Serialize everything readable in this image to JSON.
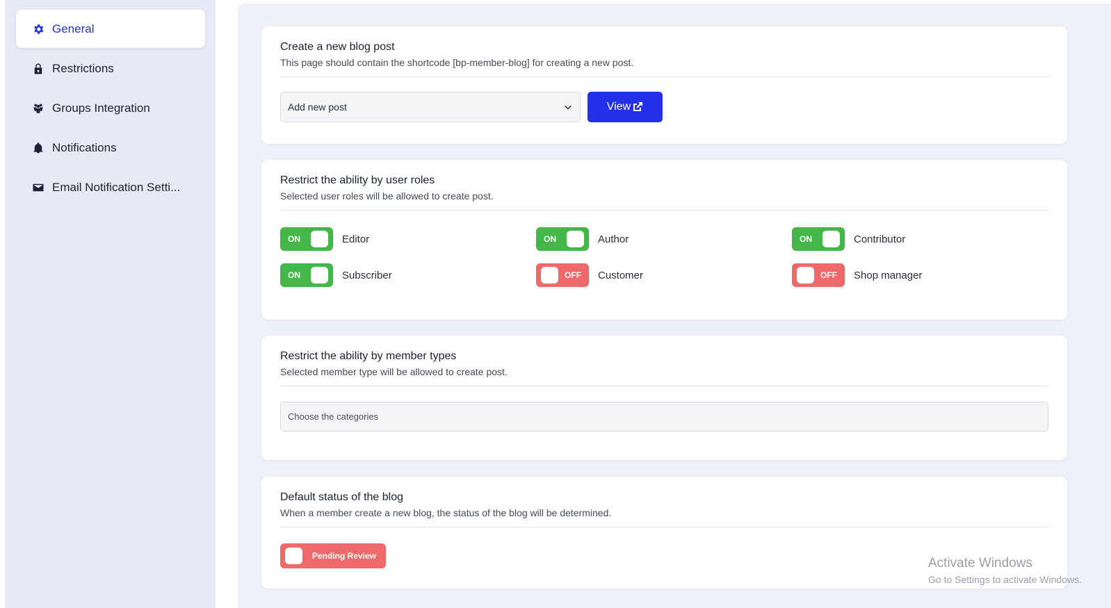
{
  "sidebar": {
    "items": [
      {
        "label": "General",
        "icon": "gear-icon",
        "active": true
      },
      {
        "label": "Restrictions",
        "icon": "lock-icon",
        "active": false
      },
      {
        "label": "Groups Integration",
        "icon": "users-icon",
        "active": false
      },
      {
        "label": "Notifications",
        "icon": "bell-icon",
        "active": false
      },
      {
        "label": "Email Notification Setti...",
        "icon": "envelope-icon",
        "active": false
      }
    ]
  },
  "new_post": {
    "title": "Create a new blog post",
    "description": "This page should contain the shortcode [bp-member-blog] for creating a new post.",
    "select_value": "Add new post",
    "view_label": "View"
  },
  "user_roles": {
    "title": "Restrict the ability by user roles",
    "description": "Selected user roles will be allowed to create post.",
    "roles": [
      {
        "name": "Editor",
        "state": "ON"
      },
      {
        "name": "Author",
        "state": "ON"
      },
      {
        "name": "Contributor",
        "state": "ON"
      },
      {
        "name": "Subscriber",
        "state": "ON"
      },
      {
        "name": "Customer",
        "state": "OFF"
      },
      {
        "name": "Shop manager",
        "state": "OFF"
      }
    ]
  },
  "member_types": {
    "title": "Restrict the ability by member types",
    "description": "Selected member type will be allowed to create post.",
    "placeholder": "Choose the categories"
  },
  "default_status": {
    "title": "Default status of the blog",
    "description": "When a member create a new blog, the status of the blog will be determined.",
    "toggle_label": "Pending Review"
  },
  "watermark": {
    "line1": "Activate Windows",
    "line2": "Go to Settings to activate Windows."
  },
  "colors": {
    "accent": "#2430ea",
    "on": "#45b649",
    "off": "#ee6a6a"
  }
}
